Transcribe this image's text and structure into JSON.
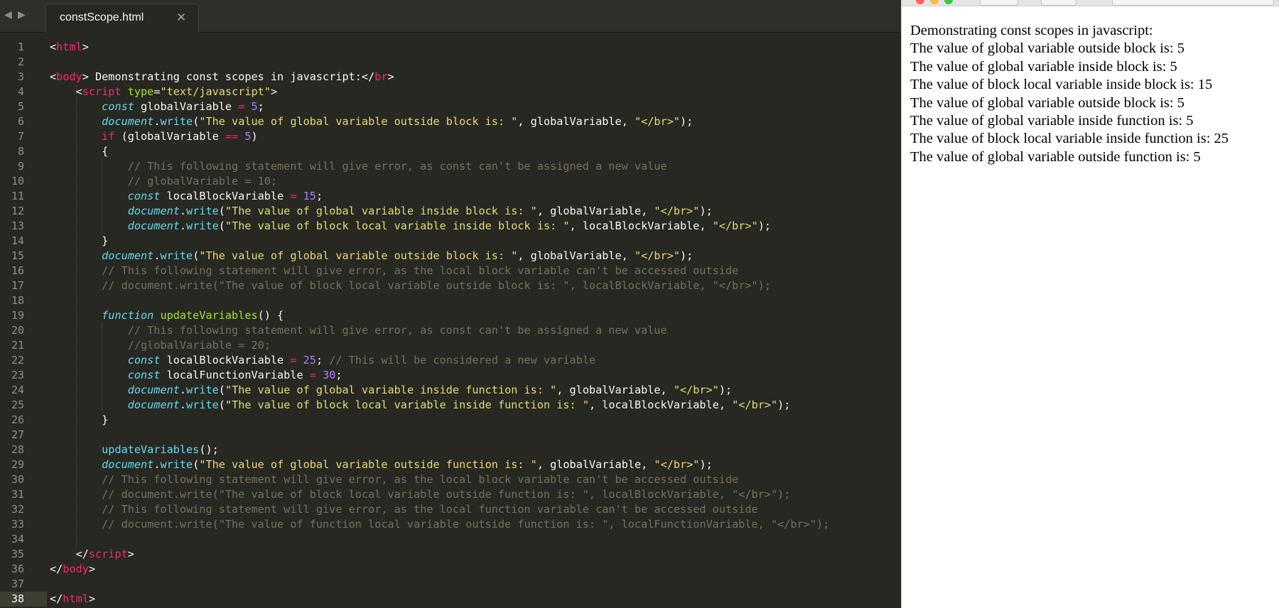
{
  "tab": {
    "back_icon": "◀",
    "forward_icon": "▶",
    "filename": "constScope.html",
    "close_icon": "✕"
  },
  "editor": {
    "current_line": 38,
    "lines": [
      [
        [
          "tx",
          "<"
        ],
        [
          "tag",
          "html"
        ],
        [
          "tx",
          ">"
        ]
      ],
      [],
      [
        [
          "tx",
          "<"
        ],
        [
          "tag",
          "body"
        ],
        [
          "tx",
          "> Demonstrating const scopes in javascript:</"
        ],
        [
          "tag",
          "br"
        ],
        [
          "tx",
          ">"
        ]
      ],
      [
        [
          "tx",
          "    <"
        ],
        [
          "tag",
          "script"
        ],
        [
          "tx",
          " "
        ],
        [
          "attr",
          "type"
        ],
        [
          "tx",
          "="
        ],
        [
          "str",
          "\"text/javascript\""
        ],
        [
          "tx",
          ">"
        ]
      ],
      [
        [
          "tx",
          "        "
        ],
        [
          "st",
          "const"
        ],
        [
          "tx",
          " globalVariable "
        ],
        [
          "op",
          "="
        ],
        [
          "tx",
          " "
        ],
        [
          "num",
          "5"
        ],
        [
          "tx",
          ";"
        ]
      ],
      [
        [
          "tx",
          "        "
        ],
        [
          "st",
          "document"
        ],
        [
          "tx",
          "."
        ],
        [
          "fn",
          "write"
        ],
        [
          "tx",
          "("
        ],
        [
          "str",
          "\"The value of global variable outside block is: \""
        ],
        [
          "tx",
          ", globalVariable, "
        ],
        [
          "str",
          "\"</br>\""
        ],
        [
          "tx",
          ");"
        ]
      ],
      [
        [
          "tx",
          "        "
        ],
        [
          "kw",
          "if"
        ],
        [
          "tx",
          " (globalVariable "
        ],
        [
          "op",
          "=="
        ],
        [
          "tx",
          " "
        ],
        [
          "num",
          "5"
        ],
        [
          "tx",
          ")"
        ]
      ],
      [
        [
          "tx",
          "        {"
        ]
      ],
      [
        [
          "tx",
          "            "
        ],
        [
          "cm",
          "// This following statement will give error, as const can't be assigned a new value"
        ]
      ],
      [
        [
          "tx",
          "            "
        ],
        [
          "cm",
          "// globalVariable = 10;"
        ]
      ],
      [
        [
          "tx",
          "            "
        ],
        [
          "st",
          "const"
        ],
        [
          "tx",
          " localBlockVariable "
        ],
        [
          "op",
          "="
        ],
        [
          "tx",
          " "
        ],
        [
          "num",
          "15"
        ],
        [
          "tx",
          ";"
        ]
      ],
      [
        [
          "tx",
          "            "
        ],
        [
          "st",
          "document"
        ],
        [
          "tx",
          "."
        ],
        [
          "fn",
          "write"
        ],
        [
          "tx",
          "("
        ],
        [
          "str",
          "\"The value of global variable inside block is: \""
        ],
        [
          "tx",
          ", globalVariable, "
        ],
        [
          "str",
          "\"</br>\""
        ],
        [
          "tx",
          ");"
        ]
      ],
      [
        [
          "tx",
          "            "
        ],
        [
          "st",
          "document"
        ],
        [
          "tx",
          "."
        ],
        [
          "fn",
          "write"
        ],
        [
          "tx",
          "("
        ],
        [
          "str",
          "\"The value of block local variable inside block is: \""
        ],
        [
          "tx",
          ", localBlockVariable, "
        ],
        [
          "str",
          "\"</br>\""
        ],
        [
          "tx",
          ");"
        ]
      ],
      [
        [
          "tx",
          "        }"
        ]
      ],
      [
        [
          "tx",
          "        "
        ],
        [
          "st",
          "document"
        ],
        [
          "tx",
          "."
        ],
        [
          "fn",
          "write"
        ],
        [
          "tx",
          "("
        ],
        [
          "str",
          "\"The value of global variable outside block is: \""
        ],
        [
          "tx",
          ", globalVariable, "
        ],
        [
          "str",
          "\"</br>\""
        ],
        [
          "tx",
          ");"
        ]
      ],
      [
        [
          "tx",
          "        "
        ],
        [
          "cm",
          "// This following statement will give error, as the local block variable can't be accessed outside"
        ]
      ],
      [
        [
          "tx",
          "        "
        ],
        [
          "cm",
          "// document.write(\"The value of block local variable outside block is: \", localBlockVariable, \"</br>\");"
        ]
      ],
      [],
      [
        [
          "tx",
          "        "
        ],
        [
          "st",
          "function"
        ],
        [
          "tx",
          " "
        ],
        [
          "fnname",
          "updateVariables"
        ],
        [
          "tx",
          "() {"
        ]
      ],
      [
        [
          "tx",
          "            "
        ],
        [
          "cm",
          "// This following statement will give error, as const can't be assigned a new value"
        ]
      ],
      [
        [
          "tx",
          "            "
        ],
        [
          "cm",
          "//globalVariable = 20;"
        ]
      ],
      [
        [
          "tx",
          "            "
        ],
        [
          "st",
          "const"
        ],
        [
          "tx",
          " localBlockVariable "
        ],
        [
          "op",
          "="
        ],
        [
          "tx",
          " "
        ],
        [
          "num",
          "25"
        ],
        [
          "tx",
          "; "
        ],
        [
          "cm",
          "// This will be considered a new variable"
        ]
      ],
      [
        [
          "tx",
          "            "
        ],
        [
          "st",
          "const"
        ],
        [
          "tx",
          " localFunctionVariable "
        ],
        [
          "op",
          "="
        ],
        [
          "tx",
          " "
        ],
        [
          "num",
          "30"
        ],
        [
          "tx",
          ";"
        ]
      ],
      [
        [
          "tx",
          "            "
        ],
        [
          "st",
          "document"
        ],
        [
          "tx",
          "."
        ],
        [
          "fn",
          "write"
        ],
        [
          "tx",
          "("
        ],
        [
          "str",
          "\"The value of global variable inside function is: \""
        ],
        [
          "tx",
          ", globalVariable, "
        ],
        [
          "str",
          "\"</br>\""
        ],
        [
          "tx",
          ");"
        ]
      ],
      [
        [
          "tx",
          "            "
        ],
        [
          "st",
          "document"
        ],
        [
          "tx",
          "."
        ],
        [
          "fn",
          "write"
        ],
        [
          "tx",
          "("
        ],
        [
          "str",
          "\"The value of block local variable inside function is: \""
        ],
        [
          "tx",
          ", localBlockVariable, "
        ],
        [
          "str",
          "\"</br>\""
        ],
        [
          "tx",
          ");"
        ]
      ],
      [
        [
          "tx",
          "        }"
        ]
      ],
      [],
      [
        [
          "tx",
          "        "
        ],
        [
          "fn",
          "updateVariables"
        ],
        [
          "tx",
          "();"
        ]
      ],
      [
        [
          "tx",
          "        "
        ],
        [
          "st",
          "document"
        ],
        [
          "tx",
          "."
        ],
        [
          "fn",
          "write"
        ],
        [
          "tx",
          "("
        ],
        [
          "str",
          "\"The value of global variable outside function is: \""
        ],
        [
          "tx",
          ", globalVariable, "
        ],
        [
          "str",
          "\"</br>\""
        ],
        [
          "tx",
          ");"
        ]
      ],
      [
        [
          "tx",
          "        "
        ],
        [
          "cm",
          "// This following statement will give error, as the local block variable can't be accessed outside"
        ]
      ],
      [
        [
          "tx",
          "        "
        ],
        [
          "cm",
          "// document.write(\"The value of block local variable outside function is: \", localBlockVariable, \"</br>\");"
        ]
      ],
      [
        [
          "tx",
          "        "
        ],
        [
          "cm",
          "// This following statement will give error, as the local function variable can't be accessed outside"
        ]
      ],
      [
        [
          "tx",
          "        "
        ],
        [
          "cm",
          "// document.write(\"The value of function local variable outside function is: \", localFunctionVariable, \"</br>\");"
        ]
      ],
      [],
      [
        [
          "tx",
          "    </"
        ],
        [
          "tag",
          "script"
        ],
        [
          "tx",
          ">"
        ]
      ],
      [
        [
          "tx",
          "</"
        ],
        [
          "tag",
          "body"
        ],
        [
          "tx",
          ">"
        ]
      ],
      [],
      [
        [
          "tx",
          "</"
        ],
        [
          "tag",
          "html"
        ],
        [
          "tx",
          ">"
        ]
      ]
    ]
  },
  "browser": {
    "output_lines": [
      "Demonstrating const scopes in javascript:",
      "The value of global variable outside block is: 5",
      "The value of global variable inside block is: 5",
      "The value of block local variable inside block is: 15",
      "The value of global variable outside block is: 5",
      "The value of global variable inside function is: 5",
      "The value of block local variable inside function is: 25",
      "The value of global variable outside function is: 5"
    ]
  },
  "colors": {
    "editor_bg": "#272822",
    "tag": "#f92672",
    "string": "#e6db74",
    "number": "#ae81ff",
    "storage": "#66d9ef",
    "function_name": "#a6e22e",
    "comment": "#75715e"
  }
}
